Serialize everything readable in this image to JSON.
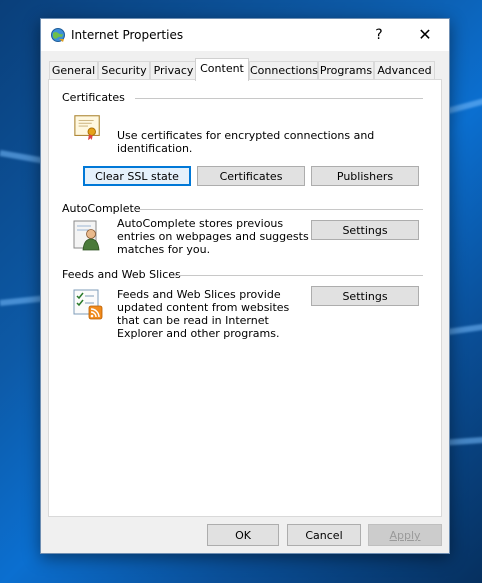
{
  "window": {
    "title": "Internet Properties",
    "help": "?",
    "close": "✕"
  },
  "tabs": [
    {
      "label": "General"
    },
    {
      "label": "Security"
    },
    {
      "label": "Privacy"
    },
    {
      "label": "Content",
      "active": true
    },
    {
      "label": "Connections"
    },
    {
      "label": "Programs"
    },
    {
      "label": "Advanced"
    }
  ],
  "certificates": {
    "title": "Certificates",
    "description": "Use certificates for encrypted connections and identification.",
    "clear_ssl": "Clear SSL state",
    "certificates_btn": "Certificates",
    "publishers_btn": "Publishers",
    "icon": "certificate-icon"
  },
  "autocomplete": {
    "title": "AutoComplete",
    "description": "AutoComplete stores previous entries on webpages and suggests matches for you.",
    "settings": "Settings",
    "icon": "autocomplete-user-icon"
  },
  "feeds": {
    "title": "Feeds and Web Slices",
    "description": "Feeds and Web Slices provide updated content from websites that can be read in Internet Explorer and other programs.",
    "settings": "Settings",
    "icon": "feed-checklist-icon"
  },
  "footer": {
    "ok": "OK",
    "cancel": "Cancel",
    "apply": "Apply"
  }
}
